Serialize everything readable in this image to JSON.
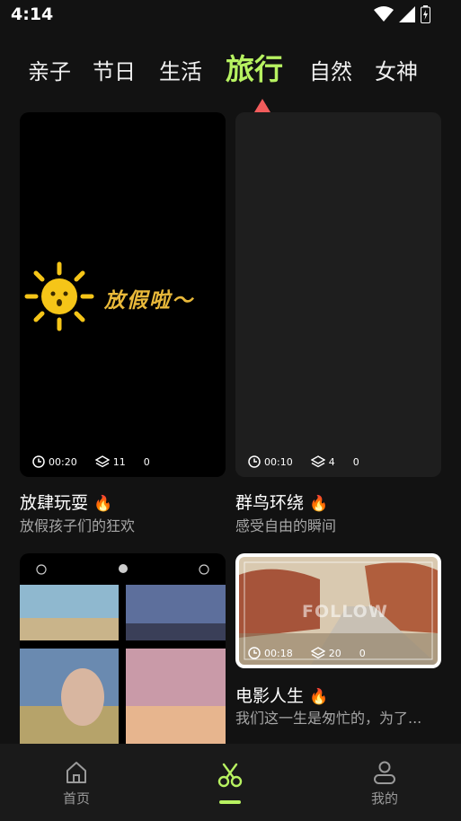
{
  "status": {
    "time": "4:14"
  },
  "tabs": [
    {
      "label": "亲子",
      "active": false
    },
    {
      "label": "节日",
      "active": false
    },
    {
      "label": "生活",
      "active": false
    },
    {
      "label": "旅行",
      "active": true
    },
    {
      "label": "自然",
      "active": false
    },
    {
      "label": "女神",
      "active": false
    }
  ],
  "cards": [
    {
      "thumb_text": "放假啦～",
      "duration": "00:20",
      "layers": "11",
      "count": "0",
      "title": "放肆玩耍",
      "subtitle": "放假孩子们的狂欢"
    },
    {
      "duration": "00:10",
      "layers": "4",
      "count": "0",
      "title": "群鸟环绕",
      "subtitle": "感受自由的瞬间"
    },
    {
      "duration": "",
      "layers": "",
      "count": "",
      "title": "",
      "subtitle": ""
    },
    {
      "thumb_text": "FOLLOW",
      "duration": "00:18",
      "layers": "20",
      "count": "0",
      "title": "电影人生",
      "subtitle": "我们这一生是匆忙的，为了..."
    }
  ],
  "nav": [
    {
      "label": "首页",
      "icon": "home-icon",
      "active": false
    },
    {
      "label": "",
      "icon": "scissors-icon",
      "active": true
    },
    {
      "label": "我的",
      "icon": "profile-icon",
      "active": false
    }
  ],
  "colors": {
    "accent": "#b7f261",
    "arrow": "#f25c5c",
    "background": "#121212"
  }
}
